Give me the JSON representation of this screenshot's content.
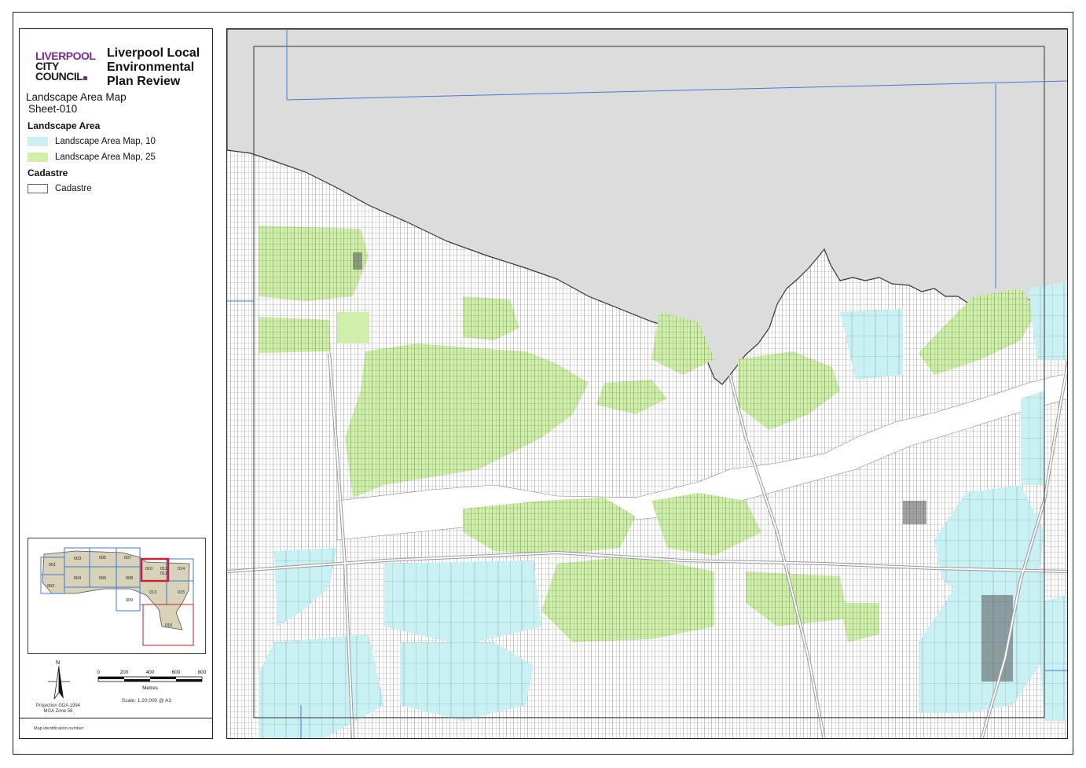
{
  "logo": {
    "line1": "LIVERPOOL",
    "line2": "CITY",
    "line3": "COUNCIL"
  },
  "title": "Liverpool Local Environmental Plan Review",
  "subtitle": "Landscape Area Map",
  "sheet": "Sheet-010",
  "legend": {
    "groups": [
      {
        "heading": "Landscape Area",
        "items": [
          {
            "label": "Landscape Area Map, 10",
            "color": "#c9f1f3"
          },
          {
            "label": "Landscape Area Map, 25",
            "color": "#cfefaa"
          }
        ]
      },
      {
        "heading": "Cadastre",
        "items": [
          {
            "label": "Cadastre",
            "color": "#ffffff"
          }
        ]
      }
    ]
  },
  "overview": {
    "sheets": [
      "001",
      "002",
      "003",
      "004",
      "005",
      "006",
      "007",
      "008",
      "009",
      "010",
      "011",
      "012",
      "013",
      "014",
      "015",
      "016"
    ],
    "current_sheet": "010",
    "highlight_color": "#d11a2a",
    "grid_color": "#3d7bd9",
    "area_color": "#d8d3b8"
  },
  "north_label": "N",
  "scale": {
    "ticks": [
      "0",
      "200",
      "400",
      "600",
      "800"
    ],
    "units": "Metres",
    "text": "Scale: 1:20,000 @ A3"
  },
  "projection": {
    "line1": "Projection GDA 1994",
    "line2": "MGA Zone 56"
  },
  "identification_label": "Map identification number:",
  "map_colors": {
    "water": "#dcdcdc",
    "landscape_10": "#c9f1f3",
    "landscape_25": "#cfefaa",
    "cadastre_line": "#6e6e6e",
    "grid_line": "#3d7bd9"
  }
}
